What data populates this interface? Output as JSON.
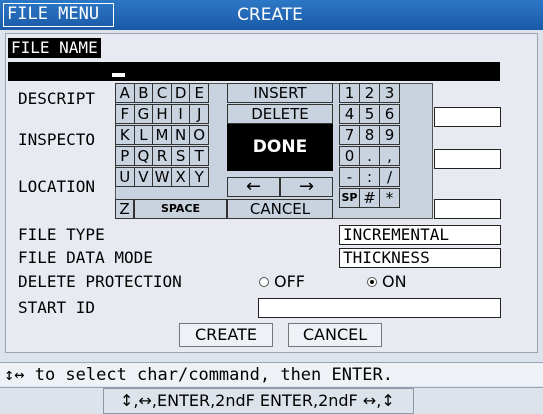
{
  "header": {
    "menu_label": "FILE MENU",
    "title": "CREATE"
  },
  "form": {
    "file_name_label": "FILE NAME",
    "description_label": "DESCRIPT",
    "inspector_label": "INSPECTO",
    "location_label": "LOCATION",
    "file_type_label": "FILE TYPE",
    "file_type_value": "INCREMENTAL",
    "data_mode_label": "FILE DATA MODE",
    "data_mode_value": "THICKNESS",
    "protection_label": "DELETE PROTECTION",
    "protection_off": "OFF",
    "protection_on": "ON",
    "protection_selected": "ON",
    "start_id_label": "START ID"
  },
  "keyboard": {
    "letters": [
      [
        "A",
        "B",
        "C",
        "D",
        "E"
      ],
      [
        "F",
        "G",
        "H",
        "I",
        "J"
      ],
      [
        "K",
        "L",
        "M",
        "N",
        "O"
      ],
      [
        "P",
        "Q",
        "R",
        "S",
        "T"
      ],
      [
        "U",
        "V",
        "W",
        "X",
        "Y"
      ]
    ],
    "z_key": "Z",
    "space_key": "SPACE",
    "insert_key": "INSERT",
    "delete_key": "DELETE",
    "done_key": "DONE",
    "left_key": "←",
    "right_key": "→",
    "cancel_key": "CANCEL",
    "symbols": [
      [
        "1",
        "2",
        "3"
      ],
      [
        "4",
        "5",
        "6"
      ],
      [
        "7",
        "8",
        "9"
      ],
      [
        "0",
        ".",
        ","
      ],
      [
        "-",
        ":",
        "/"
      ],
      [
        "SP",
        "#",
        "*"
      ]
    ]
  },
  "actions": {
    "create_label": "CREATE",
    "cancel_label": "CANCEL"
  },
  "help": {
    "line1": "↕↔ to select char/command, then ENTER.",
    "line2": "↕,↔,ENTER,2ndF ENTER,2ndF ↔,↕"
  }
}
